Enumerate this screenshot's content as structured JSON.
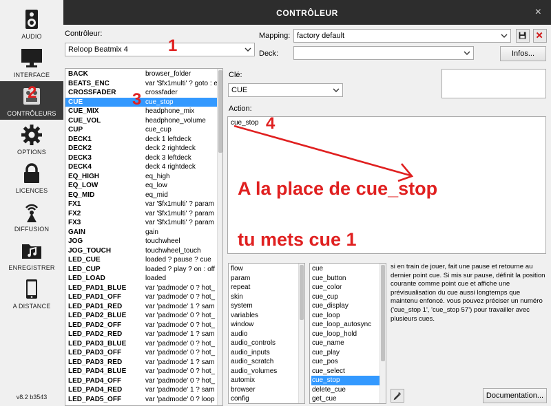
{
  "sidebar": {
    "items": [
      {
        "label": "AUDIO",
        "icon": "speaker-icon"
      },
      {
        "label": "INTERFACE",
        "icon": "monitor-icon"
      },
      {
        "label": "CONTRÔLEURS",
        "icon": "controller-icon"
      },
      {
        "label": "OPTIONS",
        "icon": "gear-icon"
      },
      {
        "label": "LICENCES",
        "icon": "lock-icon"
      },
      {
        "label": "DIFFUSION",
        "icon": "broadcast-icon"
      },
      {
        "label": "ENREGISTRER",
        "icon": "music-folder-icon"
      },
      {
        "label": "A DISTANCE",
        "icon": "phone-icon"
      }
    ],
    "active": "CONTRÔLEURS",
    "version": "v8.2 b3543"
  },
  "window": {
    "title": "CONTRÔLEUR",
    "close_label": "×"
  },
  "controller": {
    "label": "Contrôleur:",
    "value": "Reloop Beatmix 4"
  },
  "mapping": {
    "label": "Mapping:",
    "value": "factory default"
  },
  "deck": {
    "label": "Deck:",
    "value": ""
  },
  "infos_button": "Infos...",
  "key_list": [
    {
      "key": "BACK",
      "action": "browser_folder"
    },
    {
      "key": "BEATS_ENC",
      "action": "var '$fx1multi' ? goto : e"
    },
    {
      "key": "CROSSFADER",
      "action": "crossfader"
    },
    {
      "key": "CUE",
      "action": "cue_stop"
    },
    {
      "key": "CUE_MIX",
      "action": "headphone_mix"
    },
    {
      "key": "CUE_VOL",
      "action": "headphone_volume"
    },
    {
      "key": "CUP",
      "action": "cue_cup"
    },
    {
      "key": "DECK1",
      "action": "deck 1 leftdeck"
    },
    {
      "key": "DECK2",
      "action": "deck 2 rightdeck"
    },
    {
      "key": "DECK3",
      "action": "deck 3 leftdeck"
    },
    {
      "key": "DECK4",
      "action": "deck 4 rightdeck"
    },
    {
      "key": "EQ_HIGH",
      "action": "eq_high"
    },
    {
      "key": "EQ_LOW",
      "action": "eq_low"
    },
    {
      "key": "EQ_MID",
      "action": "eq_mid"
    },
    {
      "key": "FX1",
      "action": "var '$fx1multi' ? param"
    },
    {
      "key": "FX2",
      "action": "var '$fx1multi' ? param"
    },
    {
      "key": "FX3",
      "action": "var '$fx1multi' ? param"
    },
    {
      "key": "GAIN",
      "action": "gain"
    },
    {
      "key": "JOG",
      "action": "touchwheel"
    },
    {
      "key": "JOG_TOUCH",
      "action": "touchwheel_touch"
    },
    {
      "key": "LED_CUE",
      "action": "loaded ? pause ? cue"
    },
    {
      "key": "LED_CUP",
      "action": "loaded ? play ? on : off"
    },
    {
      "key": "LED_LOAD",
      "action": "loaded"
    },
    {
      "key": "LED_PAD1_BLUE",
      "action": "var 'padmode' 0 ? hot_"
    },
    {
      "key": "LED_PAD1_OFF",
      "action": "var 'padmode' 0 ? hot_"
    },
    {
      "key": "LED_PAD1_RED",
      "action": "var 'padmode' 1 ? sam"
    },
    {
      "key": "LED_PAD2_BLUE",
      "action": "var 'padmode' 0 ? hot_"
    },
    {
      "key": "LED_PAD2_OFF",
      "action": "var 'padmode' 0 ? hot_"
    },
    {
      "key": "LED_PAD2_RED",
      "action": "var 'padmode' 1 ? sam"
    },
    {
      "key": "LED_PAD3_BLUE",
      "action": "var 'padmode' 0 ? hot_"
    },
    {
      "key": "LED_PAD3_OFF",
      "action": "var 'padmode' 0 ? hot_"
    },
    {
      "key": "LED_PAD3_RED",
      "action": "var 'padmode' 1 ? sam"
    },
    {
      "key": "LED_PAD4_BLUE",
      "action": "var 'padmode' 0 ? hot_"
    },
    {
      "key": "LED_PAD4_OFF",
      "action": "var 'padmode' 0 ? hot_"
    },
    {
      "key": "LED_PAD4_RED",
      "action": "var 'padmode' 1 ? sam"
    },
    {
      "key": "LED_PAD5_OFF",
      "action": "var 'padmode' 0 ? loop"
    }
  ],
  "selected_key": "CUE",
  "cle": {
    "label": "Clé:",
    "value": "CUE"
  },
  "action": {
    "label": "Action:",
    "value": "cue_stop"
  },
  "categories": [
    "flow",
    "param",
    "repeat",
    "skin",
    "system",
    "variables",
    "window",
    "audio",
    "audio_controls",
    "audio_inputs",
    "audio_scratch",
    "audio_volumes",
    "automix",
    "browser",
    "config"
  ],
  "verbs": [
    "cue",
    "cue_button",
    "cue_color",
    "cue_cup",
    "cue_display",
    "cue_loop",
    "cue_loop_autosync",
    "cue_loop_hold",
    "cue_name",
    "cue_play",
    "cue_pos",
    "cue_select",
    "cue_stop",
    "delete_cue",
    "get_cue"
  ],
  "selected_verb": "cue_stop",
  "help_text": "si en train de jouer, fait une pause et retourne au dernier point cue. Si mis sur pause, définit la position courante comme point cue et affiche une prévisualisation du cue aussi longtemps que maintenu enfoncé. vous pouvez préciser un numéro ('cue_stop 1', 'cue_stop 57') pour travailler avec plusieurs cues.",
  "documentation_button": "Documentation...",
  "annotations": {
    "n1": "1",
    "n2": "2",
    "n3": "3",
    "n4": "4",
    "line1": "A la place de cue_stop",
    "line2": "tu mets cue 1",
    "color": "#e02020"
  },
  "colors": {
    "selection": "#3399ff",
    "titlebar": "#2d2d2d",
    "annotation": "#e02020"
  }
}
